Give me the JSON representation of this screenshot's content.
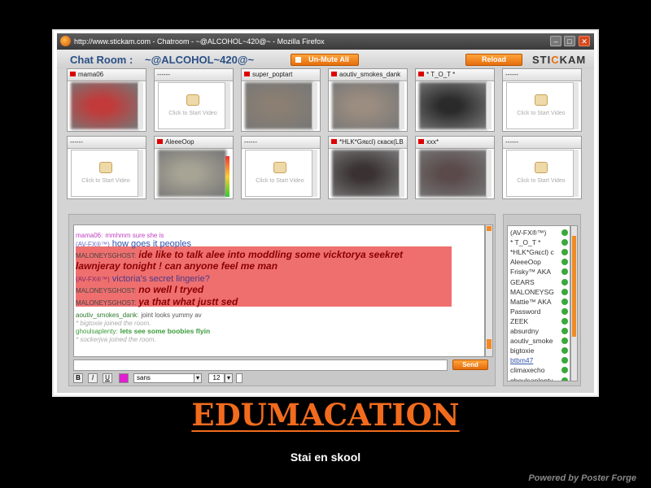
{
  "browser": {
    "title": "http://www.stickam.com - Chatroom - ~@ALCOHOL~420@~ - Mozilla Firefox"
  },
  "header": {
    "chatroom_label": "Chat Room :",
    "room_name": "~@ALCOHOL~420@~",
    "unmute_label": "Un-Mute All",
    "reload_label": "Reload",
    "logo_pre": "STI",
    "logo_accent": "C",
    "logo_post": "KAM"
  },
  "video_empty_text": "Click to Start Video",
  "tiles": [
    {
      "name": "mama06",
      "empty": false,
      "color": "#c23a3a"
    },
    {
      "name": "------",
      "empty": true
    },
    {
      "name": "super_poptart",
      "empty": false,
      "color": "#8a7f72"
    },
    {
      "name": "aoutiv_smokes_dank",
      "empty": false,
      "color": "#9b8d80"
    },
    {
      "name": "* T_O_T *",
      "empty": false,
      "color": "#2a2a2a"
    },
    {
      "name": "------",
      "empty": true
    },
    {
      "name": "------",
      "empty": true
    },
    {
      "name": "AleeeOop",
      "empty": false,
      "color": "#a7a495"
    },
    {
      "name": "------",
      "empty": true
    },
    {
      "name": "*HLK*Gяεcl) скаск(LB",
      "empty": false,
      "color": "#3a3232"
    },
    {
      "name": "xxx*",
      "empty": false,
      "color": "#5a4a4a"
    },
    {
      "name": "------",
      "empty": true
    }
  ],
  "chat": {
    "messages": [
      {
        "user": "mama06:",
        "text": "mmhmm sure she is"
      },
      {
        "user": "(AV-FX®™)",
        "text": "how goes it peoples"
      },
      {
        "user": "MALONEYSGHOST:",
        "text": "ide like to talk alee into moddling some vicktorya seekret"
      },
      {
        "user": "",
        "text": "lawnjeray  tonight ! can anyone feel me man"
      },
      {
        "user": "(AV-FX®™)",
        "text": "victoria's secret lingerie?"
      },
      {
        "user": "MALONEYSGHOST:",
        "text": "no well I tryed"
      },
      {
        "user": "MALONEYSGHOST:",
        "text": "ya that what justt sed"
      },
      {
        "user": "aoutiv_smokes_dank:",
        "text": "joint looks yummy av"
      },
      {
        "user": "",
        "text": "* bigtoxie joined the room."
      },
      {
        "user": "ghoulsaplenty:",
        "text": "lets see some boobies flyin"
      },
      {
        "user": "",
        "text": "* sockerjva joined the room."
      }
    ],
    "send_label": "Send",
    "font_name": "sans",
    "font_size": "12",
    "bold_label": "B",
    "italic_label": "I",
    "underline_label": "U",
    "text_color": "#e020d0"
  },
  "users": [
    "(AV-FX®™)",
    "* T_O_T *",
    "*HLK*Gяεcl) c",
    "AleeeOop",
    "Frisky™ AKA",
    "GEARS",
    "MALONEYSG",
    "Mattie™ AKA",
    "Password",
    "ZEEK",
    "absurdny",
    "aoutiv_smoke",
    "bigtoxie",
    "btbm47",
    "climaxecho",
    "ghoulsaplenty"
  ],
  "poster": {
    "title": "EDUMACATION",
    "subtitle": "Stai en skool",
    "powered_by": "Powered by Poster Forge"
  }
}
